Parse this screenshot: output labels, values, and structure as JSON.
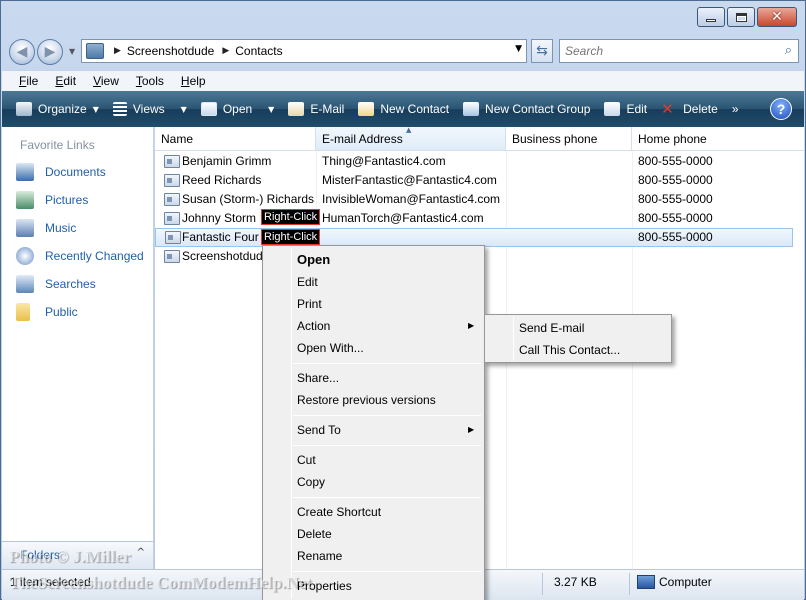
{
  "window": {
    "caption_buttons": [
      "minimize",
      "maximize",
      "close"
    ],
    "close_glyph": "✕"
  },
  "address_bar": {
    "breadcrumbs": [
      "Screenshotdude",
      "Contacts"
    ],
    "search_placeholder": "Search"
  },
  "menubar": [
    {
      "label": "File",
      "accel": "F",
      "rest": "ile"
    },
    {
      "label": "Edit",
      "accel": "E",
      "rest": "dit"
    },
    {
      "label": "View",
      "accel": "V",
      "rest": "iew"
    },
    {
      "label": "Tools",
      "accel": "T",
      "rest": "ools"
    },
    {
      "label": "Help",
      "accel": "H",
      "rest": "elp"
    }
  ],
  "toolbar": {
    "organize": "Organize",
    "views": "Views",
    "open": "Open",
    "email": "E-Mail",
    "new_contact": "New Contact",
    "new_group": "New Contact Group",
    "edit": "Edit",
    "delete": "Delete",
    "more": "»",
    "help": "?"
  },
  "sidebar": {
    "title": "Favorite Links",
    "items": [
      {
        "label": "Documents",
        "icon": "documents-icon",
        "color": "#3a6ea8"
      },
      {
        "label": "Pictures",
        "icon": "pictures-icon",
        "color": "#4a8c6a"
      },
      {
        "label": "Music",
        "icon": "music-icon",
        "color": "#5a7fb0"
      },
      {
        "label": "Recently Changed",
        "icon": "recently-changed-icon",
        "color": "#6a90c8"
      },
      {
        "label": "Searches",
        "icon": "searches-icon",
        "color": "#5a86b8"
      },
      {
        "label": "Public",
        "icon": "public-folder-icon",
        "color": "#e8c04a"
      }
    ],
    "folders_label": "Folders"
  },
  "columns": [
    "Name",
    "E-mail Address",
    "Business phone",
    "Home phone"
  ],
  "rows": [
    {
      "name": "Benjamin Grimm",
      "email": "Thing@Fantastic4.com",
      "business": "",
      "home": "800-555-0000"
    },
    {
      "name": "Reed Richards",
      "email": "MisterFantastic@Fantastic4.com",
      "business": "",
      "home": "800-555-0000"
    },
    {
      "name": "Susan (Storm-) Richards",
      "email": "InvisibleWoman@Fantastic4.com",
      "business": "",
      "home": "800-555-0000"
    },
    {
      "name": "Johnny Storm",
      "email": "HumanTorch@Fantastic4.com",
      "business": "",
      "home": "800-555-0000"
    },
    {
      "name": "Fantastic Four",
      "email": "",
      "business": "",
      "home": "800-555-0000"
    },
    {
      "name": "Screenshotdude",
      "email": "",
      "business": "",
      "home": ""
    }
  ],
  "annotations": {
    "right_click": "Right-Click"
  },
  "context_menu": {
    "open": "Open",
    "edit": "Edit",
    "print": "Print",
    "action": "Action",
    "open_with": "Open With...",
    "share": "Share...",
    "restore": "Restore previous versions",
    "send_to": "Send To",
    "cut": "Cut",
    "copy": "Copy",
    "create_shortcut": "Create Shortcut",
    "delete": "Delete",
    "rename": "Rename",
    "properties": "Properties"
  },
  "action_submenu": {
    "send_email": "Send E-mail",
    "call": "Call This Contact..."
  },
  "status": {
    "selection": "1 item selected",
    "size": "3.27 KB",
    "zone": "Computer"
  },
  "watermark": {
    "line1": "Photo © J.Miller",
    "line2": "TheScreenshotdude ComModemHelp.Net"
  }
}
